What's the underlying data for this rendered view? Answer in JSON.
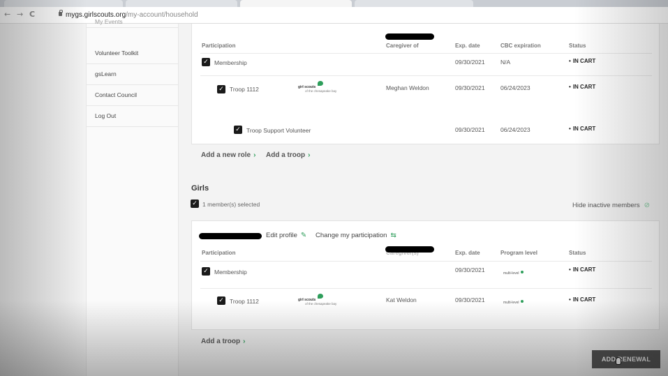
{
  "browser": {
    "url_domain": "mygs.girlscouts.org",
    "url_path": "/my-account/household",
    "back_glyph": "←",
    "forward_glyph": "→",
    "reload_glyph": "C"
  },
  "sidebar": {
    "items": [
      {
        "label": "My Events"
      },
      {
        "label": "Volunteer Toolkit"
      },
      {
        "label": "gsLearn"
      },
      {
        "label": "Contact Council"
      },
      {
        "label": "Log Out"
      }
    ]
  },
  "adult_card": {
    "headers": {
      "participation": "Participation",
      "caregiver": "Caregiver of",
      "exp_date": "Exp. date",
      "cbc": "CBC expiration",
      "status": "Status"
    },
    "rows": [
      {
        "checked": true,
        "label": "Membership",
        "caregiver": "",
        "exp": "09/30/2021",
        "cbc": "N/A",
        "status": "IN CART"
      },
      {
        "checked": true,
        "label": "Troop 1112",
        "caregiver": "Meghan Weldon",
        "exp": "09/30/2021",
        "cbc": "06/24/2023",
        "status": "IN CART"
      },
      {
        "checked": true,
        "label": "Troop Support Volunteer",
        "caregiver": "",
        "exp": "09/30/2021",
        "cbc": "06/24/2023",
        "status": "IN CART"
      }
    ],
    "add_role": "Add a new role",
    "add_troop": "Add a troop"
  },
  "logo": {
    "brand": "girl scouts",
    "council": "of the chesapeake bay"
  },
  "girls": {
    "title": "Girls",
    "selected_text": "1 member(s) selected",
    "hide_inactive": "Hide inactive members",
    "edit_profile": "Edit profile",
    "change_participation": "Change my participation",
    "headers": {
      "participation": "Participation",
      "caregiver": "Caregiver(s)",
      "exp_date": "Exp. date",
      "program_level": "Program level",
      "status": "Status"
    },
    "rows": [
      {
        "checked": true,
        "label": "Membership",
        "caregiver": "",
        "exp": "09/30/2021",
        "level": "multi-level",
        "status": "IN CART"
      },
      {
        "checked": true,
        "label": "Troop 1112",
        "caregiver": "Kat Weldon",
        "exp": "09/30/2021",
        "level": "multi-level",
        "status": "IN CART"
      }
    ],
    "add_troop": "Add a troop"
  },
  "add_renewal": "ADD RENEWAL"
}
